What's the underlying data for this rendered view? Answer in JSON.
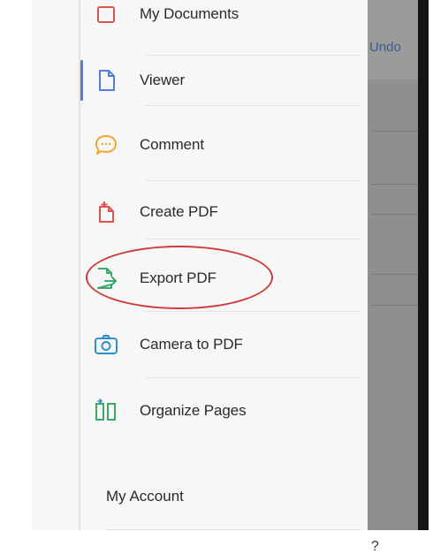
{
  "background_app": {
    "undo_label": "Undo",
    "bottom_glyph": "?"
  },
  "menu": {
    "items": [
      {
        "label": "My Documents",
        "icon": "folder-icon",
        "color": "#d9534f",
        "active": false
      },
      {
        "label": "Viewer",
        "icon": "document-icon",
        "color": "#4f7fd8",
        "active": true
      },
      {
        "label": "Comment",
        "icon": "comment-bubble-icon",
        "color": "#f0a830",
        "active": false
      },
      {
        "label": "Create PDF",
        "icon": "create-pdf-icon",
        "color": "#e05252",
        "active": false
      },
      {
        "label": "Export PDF",
        "icon": "export-pdf-icon",
        "color": "#3aa86b",
        "active": false,
        "highlighted": true
      },
      {
        "label": "Camera to PDF",
        "icon": "camera-icon",
        "color": "#2f8fc9",
        "active": false
      },
      {
        "label": "Organize Pages",
        "icon": "organize-pages-icon",
        "color": "#3aa86b",
        "active": false
      }
    ],
    "account_label": "My Account"
  },
  "colors": {
    "active_indicator": "#4f7fd8",
    "annotation": "#d23a3a"
  }
}
